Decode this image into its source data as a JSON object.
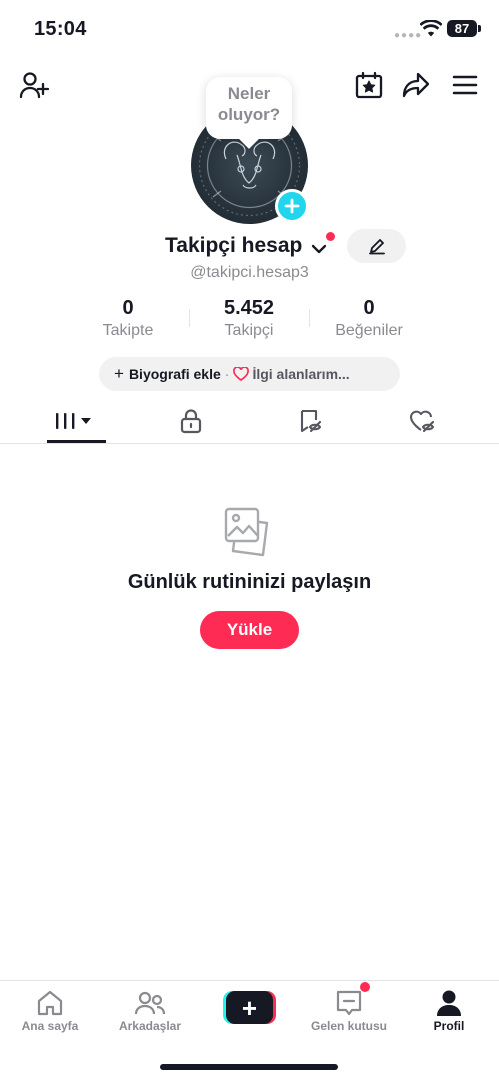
{
  "status_bar": {
    "time": "15:04",
    "battery": "87"
  },
  "top_nav": {
    "add_friend_icon": "add-user-icon",
    "calendar_icon": "calendar-star-icon",
    "share_icon": "share-arrow-icon",
    "menu_icon": "hamburger-menu-icon"
  },
  "profile": {
    "bubble_line1": "Neler",
    "bubble_line2": "oluyor?",
    "name": "Takipçi hesap",
    "handle": "@takipci.hesap3",
    "stats": [
      {
        "value": "0",
        "label": "Takipte"
      },
      {
        "value": "5.452",
        "label": "Takipçi"
      },
      {
        "value": "0",
        "label": "Beğeniler"
      }
    ],
    "bio_add": "Biyografi ekle",
    "bio_separator": "·",
    "interests": "İlgi alanlarım..."
  },
  "tabs": [
    {
      "icon": "grid-videos-icon",
      "active": true
    },
    {
      "icon": "lock-icon",
      "active": false
    },
    {
      "icon": "bookmark-hidden-icon",
      "active": false
    },
    {
      "icon": "heart-hidden-icon",
      "active": false
    }
  ],
  "empty_state": {
    "icon": "photos-icon",
    "title": "Günlük rutininizi paylaşın",
    "button": "Yükle"
  },
  "bottom_nav": {
    "items": [
      {
        "label": "Ana sayfa",
        "icon": "home-icon"
      },
      {
        "label": "Arkadaşlar",
        "icon": "friends-icon"
      },
      {
        "label": "",
        "icon": "create-plus-icon"
      },
      {
        "label": "Gelen kutusu",
        "icon": "inbox-icon"
      },
      {
        "label": "Profil",
        "icon": "profile-icon"
      }
    ]
  },
  "colors": {
    "accent": "#fe2c55",
    "cyan": "#20d5ec",
    "text": "#161823",
    "muted": "#8a8b91"
  }
}
